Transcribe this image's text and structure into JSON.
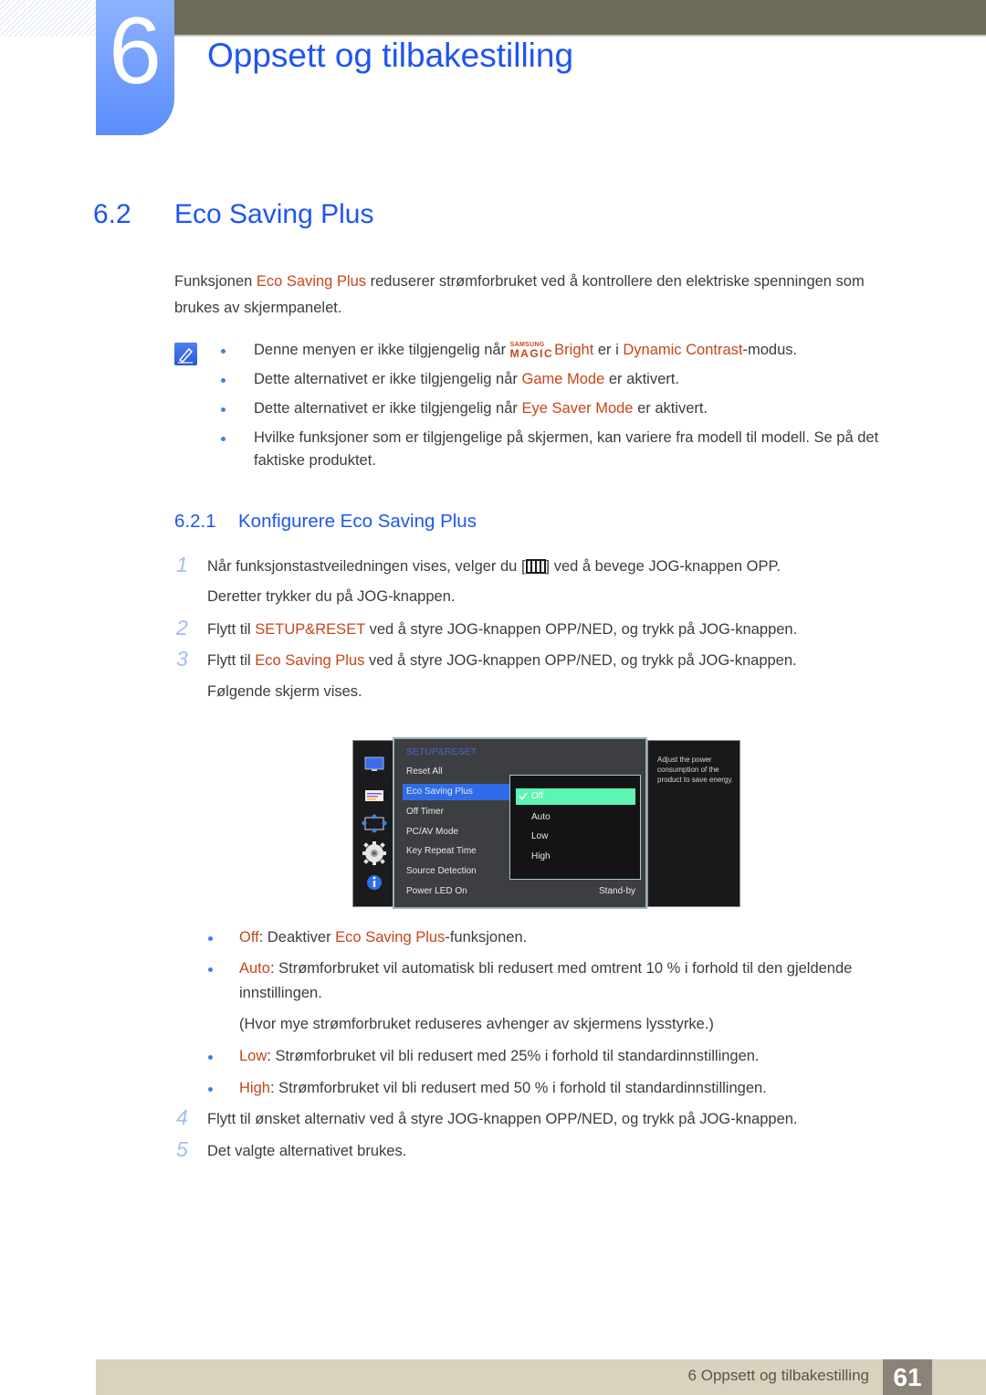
{
  "header": {
    "chapter_number": "6",
    "chapter_title": "Oppsett og tilbakestilling"
  },
  "section": {
    "number": "6.2",
    "title": "Eco Saving Plus"
  },
  "intro": {
    "line1_pre": "Funksjonen ",
    "line1_hl": "Eco Saving Plus",
    "line1_post": " reduserer strømforbruket ved å kontrollere den elektriske spenningen som",
    "line2": "brukes av skjermpanelet."
  },
  "notes": {
    "icon": "note-pencil-icon",
    "items": [
      {
        "pre": "Denne menyen er ikke tilgjengelig når ",
        "magic_top": "SAMSUNG",
        "magic_bottom": "MAGIC",
        "hl1": "Bright",
        "mid": " er i ",
        "hl2": "Dynamic Contrast",
        "post": "-modus."
      },
      {
        "pre": "Dette alternativet er ikke tilgjengelig når ",
        "hl": "Game Mode",
        "post": " er aktivert."
      },
      {
        "pre": "Dette alternativet er ikke tilgjengelig når ",
        "hl": "Eye Saver Mode",
        "post": " er aktivert."
      },
      {
        "line1": "Hvilke funksjoner som er tilgjengelige på skjermen, kan variere fra modell til modell. Se på det",
        "line2": "faktiske produktet."
      }
    ]
  },
  "subsection": {
    "number": "6.2.1",
    "title": "Konfigurere Eco Saving Plus"
  },
  "steps": [
    {
      "num": "1",
      "pre": "Når funksjonstastveiledningen vises, velger du [",
      "icon": "menu-icon",
      "post": "] ved å bevege JOG-knappen OPP.",
      "line2": "Deretter trykker du på JOG-knappen."
    },
    {
      "num": "2",
      "pre": "Flytt til ",
      "hl": "SETUP&RESET",
      "post": " ved å styre JOG-knappen OPP/NED, og trykk på JOG-knappen."
    },
    {
      "num": "3",
      "pre": "Flytt til ",
      "hl": "Eco Saving Plus",
      "post": " ved å styre JOG-knappen OPP/NED, og trykk på JOG-knappen.",
      "line2": "Følgende skjerm vises."
    },
    {
      "num": "4",
      "text": "Flytt til ønsket alternativ ved å styre JOG-knappen OPP/NED, og trykk på JOG-knappen."
    },
    {
      "num": "5",
      "text": "Det valgte alternativet brukes."
    }
  ],
  "osd": {
    "side_icons": [
      "monitor-icon",
      "picture-settings-icon",
      "position-icon",
      "gear-icon",
      "info-icon"
    ],
    "menu_title": "SETUP&RESET",
    "menu_items": [
      "Reset All",
      "Eco Saving Plus",
      "Off Timer",
      "PC/AV Mode",
      "Key Repeat Time",
      "Source Detection",
      "Power LED On"
    ],
    "selected_item": "Eco Saving Plus",
    "power_led_value": "Stand-by",
    "options": [
      "Off",
      "Auto",
      "Low",
      "High"
    ],
    "selected_option": "Off",
    "help_text": "Adjust the power consumption of the product to save energy."
  },
  "option_desc": [
    {
      "hl": "Off",
      "pre": ": Deaktiver ",
      "hl2": "Eco Saving Plus",
      "post": "-funksjonen."
    },
    {
      "hl": "Auto",
      "text": ": Strømforbruket vil automatisk bli redusert med omtrent 10 % i forhold til den gjeldende",
      "line2": "innstillingen.",
      "line3": "(Hvor mye strømforbruket reduseres avhenger av skjermens lysstyrke.)"
    },
    {
      "hl": "Low",
      "text": ": Strømforbruket vil bli redusert med 25% i forhold til standardinnstillingen."
    },
    {
      "hl": "High",
      "text": ": Strømforbruket vil bli redusert med 50 % i forhold til standardinnstillingen."
    }
  ],
  "footer": {
    "chapter_label": "6 Oppsett og tilbakestilling",
    "page_number": "61"
  },
  "colors": {
    "heading_blue": "#1f55f1",
    "highlight_orange": "#c8451a",
    "top_bar": "#6d6b57",
    "footer_bg": "#d8d3bf",
    "page_box": "#8c8378"
  }
}
